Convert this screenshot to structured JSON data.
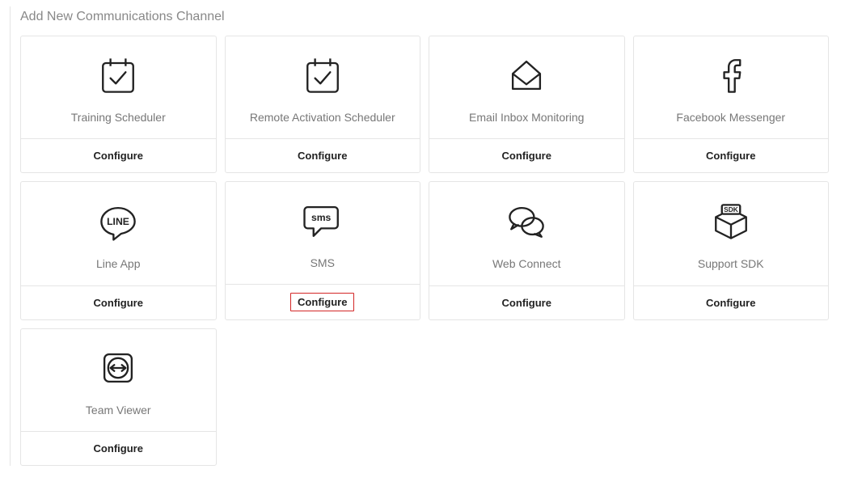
{
  "title": "Add New Communications Channel",
  "configure_label": "Configure",
  "channels": [
    {
      "id": "training-scheduler",
      "label": "Training Scheduler",
      "icon": "calendar-check-icon",
      "highlighted": false
    },
    {
      "id": "remote-activation-scheduler",
      "label": "Remote Activation Scheduler",
      "icon": "calendar-check-icon",
      "highlighted": false
    },
    {
      "id": "email-inbox-monitoring",
      "label": "Email Inbox Monitoring",
      "icon": "envelope-open-icon",
      "highlighted": false
    },
    {
      "id": "facebook-messenger",
      "label": "Facebook Messenger",
      "icon": "facebook-icon",
      "highlighted": false
    },
    {
      "id": "line-app",
      "label": "Line App",
      "icon": "line-icon",
      "highlighted": false
    },
    {
      "id": "sms",
      "label": "SMS",
      "icon": "sms-icon",
      "highlighted": true
    },
    {
      "id": "web-connect",
      "label": "Web Connect",
      "icon": "chat-bubbles-icon",
      "highlighted": false
    },
    {
      "id": "support-sdk",
      "label": "Support SDK",
      "icon": "sdk-box-icon",
      "highlighted": false
    },
    {
      "id": "team-viewer",
      "label": "Team Viewer",
      "icon": "teamviewer-icon",
      "highlighted": false
    }
  ]
}
